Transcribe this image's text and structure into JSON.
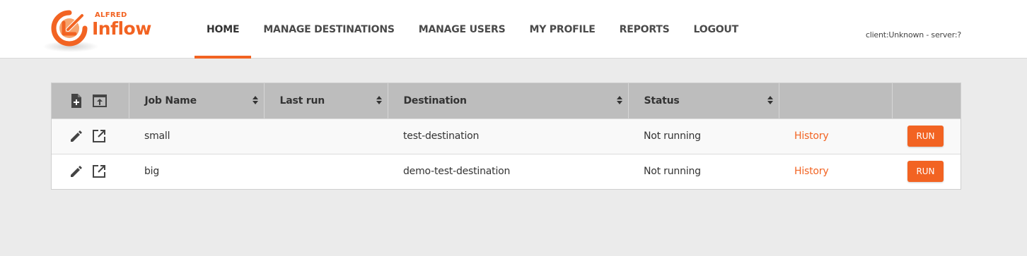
{
  "logo": {
    "small_text": "ALFRED",
    "big_text": "Inflow"
  },
  "nav": {
    "items": [
      {
        "label": "HOME",
        "active": true
      },
      {
        "label": "MANAGE DESTINATIONS"
      },
      {
        "label": "MANAGE USERS"
      },
      {
        "label": "MY PROFILE"
      },
      {
        "label": "REPORTS"
      },
      {
        "label": "LOGOUT"
      }
    ]
  },
  "server_info": "client:Unknown - server:?",
  "table": {
    "header_icons": [
      "new-file-icon",
      "upload-icon"
    ],
    "columns": [
      "Job Name",
      "Last run",
      "Destination",
      "Status",
      "",
      ""
    ],
    "rows": [
      {
        "job_name": "small",
        "last_run": "",
        "destination": "test-destination",
        "status": "Not running",
        "history": "History",
        "run": "RUN"
      },
      {
        "job_name": "big",
        "last_run": "",
        "destination": "demo-test-destination",
        "status": "Not running",
        "history": "History",
        "run": "RUN"
      }
    ]
  },
  "colors": {
    "accent": "#f26322",
    "header_bg": "#bdbdbd",
    "page_bg": "#ebebeb"
  }
}
